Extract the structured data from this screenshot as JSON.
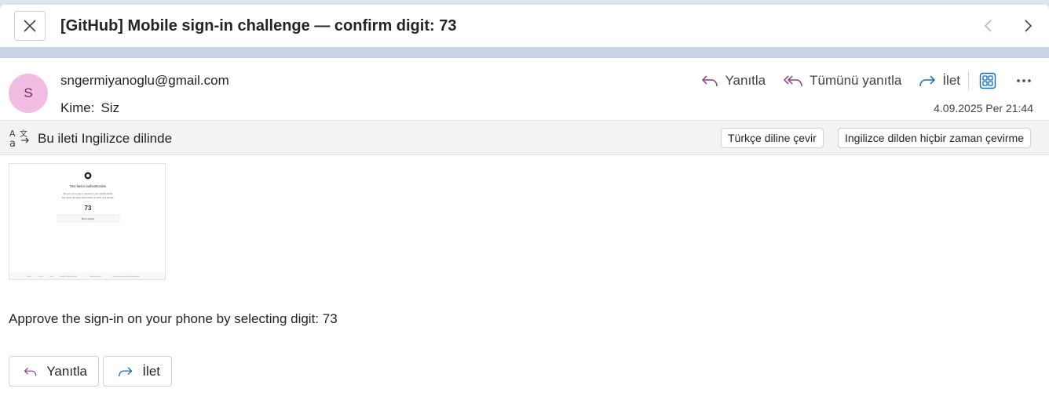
{
  "subject": "[GitHub] Mobile sign-in challenge — confirm digit: 73",
  "icons": {
    "close": "close-icon",
    "prev": "chevron-left-icon",
    "next": "chevron-right-icon",
    "reply": "reply-icon",
    "reply_all": "reply-all-icon",
    "forward": "forward-icon",
    "apps": "apps-grid-icon",
    "more": "more-icon",
    "translate": "translate-icon"
  },
  "header": {
    "avatar_initial": "S",
    "sender": "sngermiyanoglu@gmail.com",
    "to_label": "Kime:",
    "to_value": "Siz",
    "date": "4.09.2025 Per 21:44"
  },
  "actions": {
    "reply": "Yanıtla",
    "reply_all": "Tümünü yanıtla",
    "forward": "İlet"
  },
  "translate": {
    "message": "Bu ileti Ingilizce dilinde",
    "translate_button": "Türkçe diline çevir",
    "never_button": "Ingilizce dilden hiçbir zaman çevirme"
  },
  "thumbnail": {
    "title": "Two-factor authentication",
    "line1": "We sent you a sign-in request on your GitHub Mobile",
    "line2": "app. Enter the digits shown below to verify your identity.",
    "digit": "73",
    "more_options": "More options",
    "footer": [
      "Terms",
      "Privacy",
      "Docs",
      "Contact GitHub Support",
      "Manage cookies",
      "Do not share my personal information"
    ]
  },
  "body": "Approve the sign-in on your phone by selecting digit: 73",
  "bottom": {
    "reply": "Yanıtla",
    "forward": "İlet"
  },
  "colors": {
    "accent_purple": "#8a3a8a",
    "accent_blue": "#0f6cbd",
    "avatar_bg": "#f1bde3",
    "header_band": "#c6d0e6"
  }
}
